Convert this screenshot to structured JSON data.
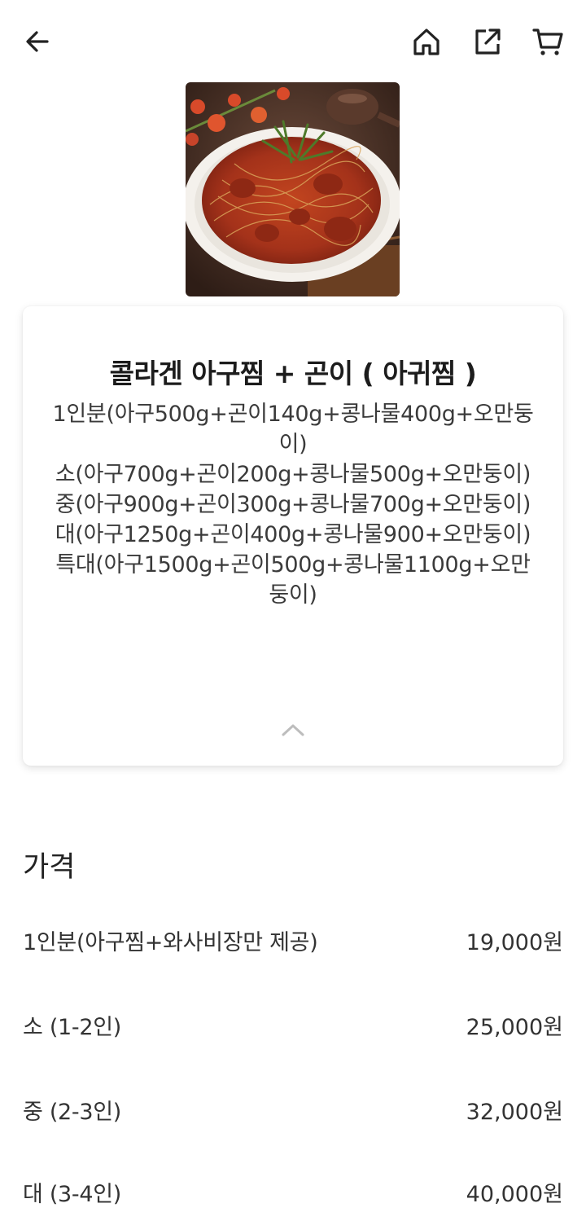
{
  "header": {
    "icons": [
      "back-arrow-icon",
      "home-icon",
      "share-icon",
      "cart-icon"
    ]
  },
  "product": {
    "title": "콜라겐 아구찜 + 곤이 ( 아귀찜 )",
    "description_lines": [
      "1인분(아구500g+곤이140g+콩나물400g+오만둥이)",
      "소(아구700g+곤이200g+콩나물500g+오만둥이)",
      "중(아구900g+곤이300g+콩나물700g+오만둥이)",
      "대(아구1250g+곤이400g+콩나물900+오만둥이)",
      "특대(아구1500g+곤이500g+콩나물1100g+오만둥이)"
    ]
  },
  "price": {
    "section_title": "가격",
    "rows": [
      {
        "name": "1인분(아구찜+와사비장만 제공)",
        "value": "19,000원"
      },
      {
        "name": "소 (1-2인)",
        "value": "25,000원"
      },
      {
        "name": "중 (2-3인)",
        "value": "32,000원"
      },
      {
        "name": "대 (3-4인)",
        "value": "40,000원"
      }
    ]
  }
}
